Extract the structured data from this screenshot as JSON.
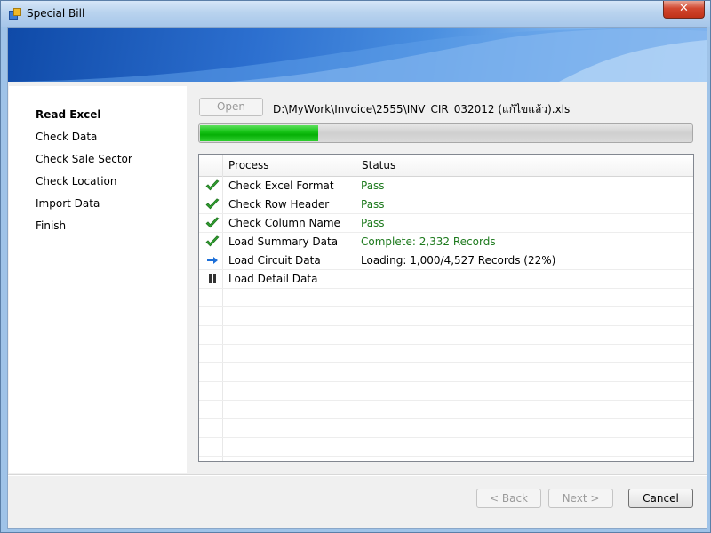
{
  "window": {
    "title": "Special Bill",
    "close_label": "✕"
  },
  "steps": [
    {
      "label": "Read Excel",
      "active": true
    },
    {
      "label": "Check Data",
      "active": false
    },
    {
      "label": "Check Sale Sector",
      "active": false
    },
    {
      "label": "Check Location",
      "active": false
    },
    {
      "label": "Import Data",
      "active": false
    },
    {
      "label": "Finish",
      "active": false
    }
  ],
  "file": {
    "open_label": "Open",
    "path": "D:\\MyWork\\Invoice\\2555\\INV_CIR_032012 (แก้ไขแล้ว).xls"
  },
  "progress": {
    "fraction": 0.24
  },
  "grid": {
    "columns": [
      "Process",
      "Status"
    ],
    "rows": [
      {
        "icon": "check-icon",
        "process": "Check Excel Format",
        "status": "Pass",
        "status_color": "#1e7a1e"
      },
      {
        "icon": "check-icon",
        "process": "Check Row Header",
        "status": "Pass",
        "status_color": "#1e7a1e"
      },
      {
        "icon": "check-icon",
        "process": "Check Column Name",
        "status": "Pass",
        "status_color": "#1e7a1e"
      },
      {
        "icon": "check-icon",
        "process": "Load Summary Data",
        "status": "Complete: 2,332 Records",
        "status_color": "#1e7a1e"
      },
      {
        "icon": "arrow-right-icon",
        "process": "Load Circuit Data",
        "status": "Loading: 1,000/4,527 Records (22%)",
        "status_color": "#000000"
      },
      {
        "icon": "pause-icon",
        "process": "Load Detail Data",
        "status": "",
        "status_color": "#000000"
      }
    ]
  },
  "buttons": {
    "back_label": "< Back",
    "next_label": "Next >",
    "cancel_label": "Cancel"
  },
  "colors": {
    "accent_green": "#17c417",
    "pass_green": "#1e7a1e",
    "arrow_blue": "#1d6fd8"
  }
}
